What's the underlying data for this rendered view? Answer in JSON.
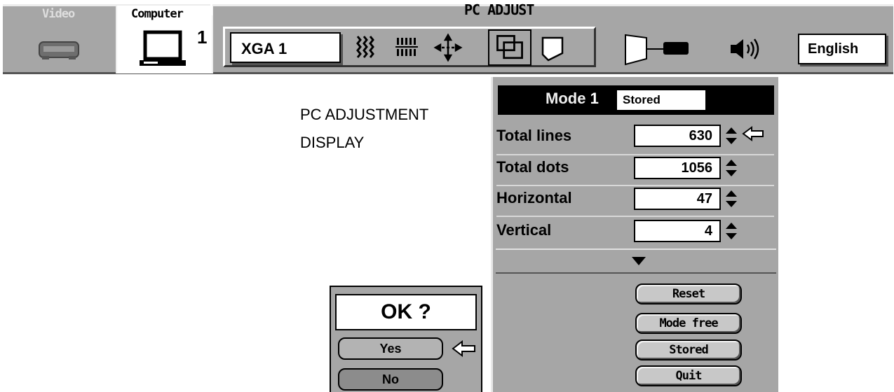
{
  "topbar": {
    "title": "PC ADJUST",
    "tabs": [
      {
        "label": "Video",
        "icon": "vcr-icon"
      },
      {
        "label": "Computer",
        "icon": "monitor-icon",
        "number": "1"
      }
    ],
    "mode_select": "XGA 1",
    "tools": [
      "fine-sync-icon",
      "total-dots-icon",
      "position-icon",
      "pc-adjust-icon",
      "screen-icon"
    ],
    "selected_tool": "pc-adjust-icon",
    "language": "English"
  },
  "caption": {
    "line1": "PC ADJUSTMENT",
    "line2": "DISPLAY"
  },
  "panel": {
    "mode_label": "Mode",
    "mode_number": "1",
    "mode_status": "Stored",
    "rows": [
      {
        "label": "Total lines",
        "value": "630"
      },
      {
        "label": "Total dots",
        "value": "1056"
      },
      {
        "label": "Horizontal",
        "value": "47"
      },
      {
        "label": "Vertical",
        "value": "4"
      }
    ],
    "buttons": [
      "Reset",
      "Mode free",
      "Stored",
      "Quit"
    ]
  },
  "dialog": {
    "question": "OK ?",
    "yes": "Yes",
    "no": "No"
  },
  "colors": {
    "panel_gray": "#a6a6a6",
    "header_black": "#000000",
    "field_white": "#ffffff"
  }
}
